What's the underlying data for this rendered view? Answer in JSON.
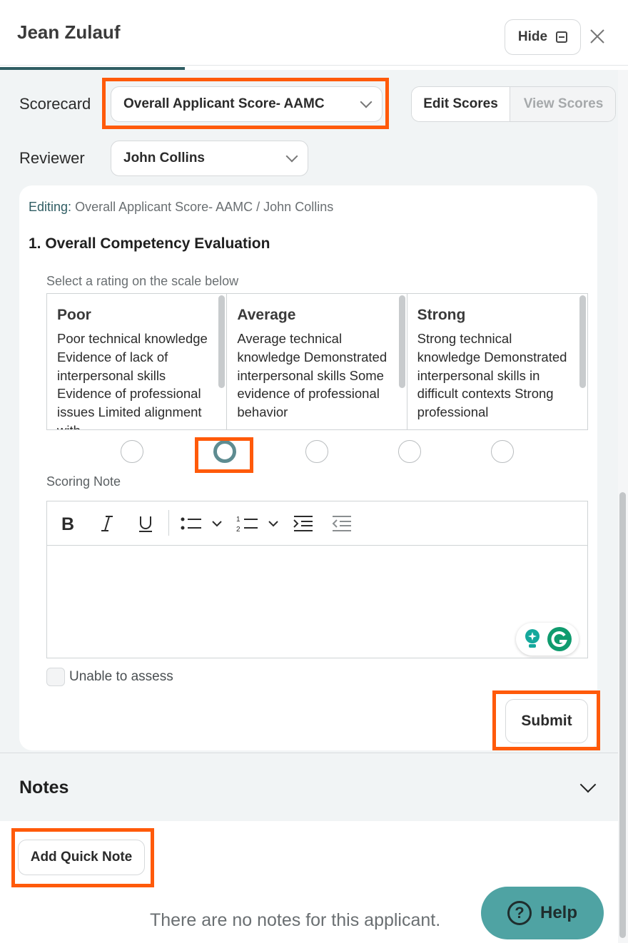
{
  "header": {
    "title": "Jean Zulauf",
    "hide_label": "Hide"
  },
  "scorecard": {
    "label": "Scorecard",
    "selected": "Overall Applicant Score- AAMC",
    "edit_scores": "Edit Scores",
    "view_scores": "View Scores"
  },
  "reviewer": {
    "label": "Reviewer",
    "selected": "John Collins"
  },
  "card": {
    "editing_label": "Editing:",
    "editing_value": "Overall Applicant Score- AAMC / John Collins",
    "question": "1. Overall Competency Evaluation",
    "scale_hint": "Select a rating on the scale below",
    "scale": [
      {
        "title": "Poor",
        "desc": "Poor technical knowledge Evidence of lack of interpersonal skills Evidence of professional issues Limited alignment with"
      },
      {
        "title": "Average",
        "desc": "Average technical knowledge Demonstrated interpersonal skills Some evidence of professional behavior"
      },
      {
        "title": "Strong",
        "desc": "Strong technical knowledge Demonstrated interpersonal skills in difficult contexts Strong professional"
      }
    ],
    "selected_rating_index": 1,
    "scoring_note_label": "Scoring Note",
    "unable_to_assess": "Unable to assess",
    "submit": "Submit"
  },
  "notes": {
    "title": "Notes",
    "add_quick_note": "Add Quick Note",
    "empty_message": "There are no notes for this applicant."
  },
  "help": {
    "label": "Help",
    "symbol": "?"
  },
  "colors": {
    "accent_teal": "#2f5d63",
    "highlight_orange": "#ff5a0a",
    "help_bg": "#4fa3a3"
  }
}
